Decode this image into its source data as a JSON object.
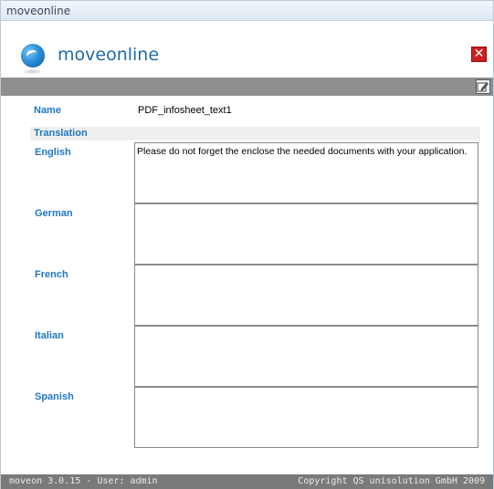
{
  "window": {
    "title": "moveonline"
  },
  "header": {
    "app_name": "moveonline",
    "close_icon": "close-icon",
    "logo_icon": "globe-logo-icon"
  },
  "toolbar": {
    "edit_icon": "edit-icon"
  },
  "form": {
    "name_label": "Name",
    "name_value": "PDF_infosheet_text1",
    "section_title": "Translation",
    "translations": [
      {
        "language": "English",
        "value": "Please do not forget the enclose the needed documents with your application."
      },
      {
        "language": "German",
        "value": ""
      },
      {
        "language": "French",
        "value": ""
      },
      {
        "language": "Italian",
        "value": ""
      },
      {
        "language": "Spanish",
        "value": ""
      }
    ]
  },
  "footer": {
    "version": "moveon 3.0.15 - User: admin",
    "copyright": "Copyright QS unisolution GmbH 2009"
  },
  "colors": {
    "accent": "#1f77c3",
    "close": "#cc1f1f",
    "bar": "#8e8e8e",
    "footer": "#7a7a7a"
  }
}
